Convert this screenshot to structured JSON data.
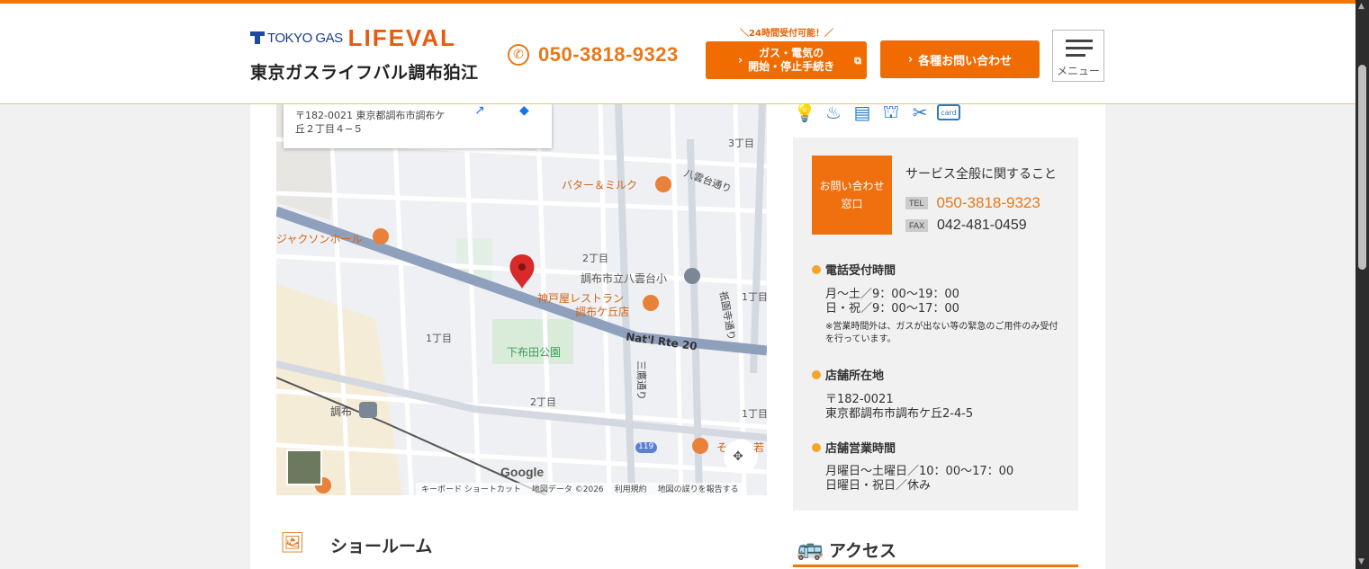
{
  "header": {
    "logo_tokyo_gas": "TOKYO GAS",
    "logo_lifeval": "LIFEVAL",
    "store_name": "東京ガスライフバル調布狛江",
    "phone": "050-3818-9323",
    "button_note": "＼24時間受付可能！／",
    "btn_gas_line1": "ガス・電気の",
    "btn_gas_line2": "開始・停止手続き",
    "btn_inquiry": "各種お問い合わせ",
    "menu_label": "メニュー",
    "accent_color": "#f07800"
  },
  "map": {
    "address_line1": "〒182-0021 東京都調布市調布ケ",
    "address_line2": "丘２丁目４−５",
    "labels": {
      "butter_milk": "バター＆ミルク",
      "jackson_hall": "ジャクソンホール",
      "kobeya": "神戸屋レストラン",
      "kobeya2": "調布ケ丘店",
      "yakumodai_school": "調布市立八雲台小",
      "route20": "Nat'l Rte 20",
      "park": "下布田公園",
      "chofu": "調布",
      "chome2a": "2丁目",
      "chome2b": "2丁目",
      "chome1a": "1丁目",
      "chome1b": "1丁目",
      "chome1c": "1丁目",
      "chome3": "3丁目",
      "yakumodai_st": "八雲台通り",
      "gion_st": "祇園寺通り",
      "mitaka_st": "三鷹通り",
      "route119": "119",
      "so": "そ",
      "waka": "若"
    },
    "google": "Google",
    "footer": [
      "キーボード ショートカット",
      "地図データ ©2026",
      "利用規約",
      "地図の誤りを報告する"
    ]
  },
  "contact": {
    "box_label_line1": "お問い合わせ",
    "box_label_line2": "窓口",
    "service_title": "サービス全般に関すること",
    "tel_tag": "TEL",
    "tel": "050-3818-9323",
    "fax_tag": "FAX",
    "fax": "042-481-0459"
  },
  "hours": {
    "title": "電話受付時間",
    "line1": "月～土／9：00～19：00",
    "line2": "日・祝／9：00～17：00",
    "note": "※営業時間外は、ガスが出ない等の緊急のご用件のみ受付を行っています。"
  },
  "location": {
    "title": "店舗所在地",
    "zip": "〒182-0021",
    "address": "東京都調布市調布ケ丘2-4-5"
  },
  "business_hours": {
    "title": "店舗営業時間",
    "line1": "月曜日～土曜日／10：00～17：00",
    "line2": "日曜日・祝日／休み"
  },
  "sections": {
    "showroom": "ショールーム",
    "access": "アクセス"
  }
}
